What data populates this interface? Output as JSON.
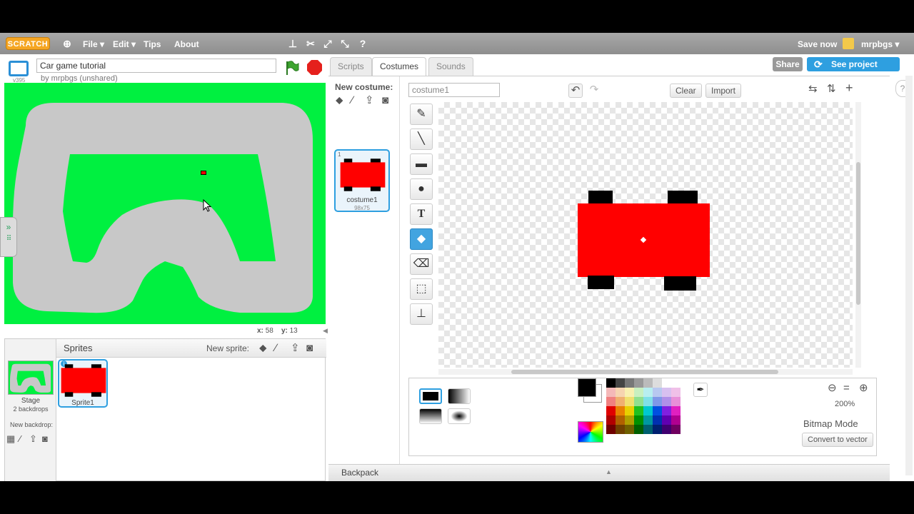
{
  "menubar": {
    "logo": "SCRATCH",
    "items": [
      "File ▾",
      "Edit ▾",
      "Tips",
      "About"
    ],
    "save_now": "Save now",
    "username": "mrpbgs ▾"
  },
  "project": {
    "title": "Car game tutorial",
    "version": "v395",
    "author": "by mrpbgs (unshared)",
    "share": "Share",
    "see_project_page": "See project page"
  },
  "stage": {
    "coords_x_label": "x:",
    "coords_x": "58",
    "coords_y_label": "y:",
    "coords_y": "13",
    "track_color": "#c8c8c8",
    "grass_color": "#00f040"
  },
  "sprites_pane": {
    "header": "Sprites",
    "new_sprite": "New sprite:",
    "stage_label": "Stage",
    "stage_sub": "2 backdrops",
    "new_backdrop": "New backdrop:",
    "sprite_name": "Sprite1"
  },
  "tabs": [
    {
      "label": "Scripts",
      "active": false
    },
    {
      "label": "Costumes",
      "active": true
    },
    {
      "label": "Sounds",
      "active": false
    }
  ],
  "costumes": {
    "new_costume": "New costume:",
    "list": [
      {
        "index": "1",
        "name": "costume1",
        "size": "98x75"
      }
    ]
  },
  "paint": {
    "costume_name": "costume1",
    "clear": "Clear",
    "import": "Import",
    "zoom": "200%",
    "mode": "Bitmap Mode",
    "convert": "Convert to vector",
    "active_tool": "fill-icon",
    "primary_color": "#000000",
    "car_color": "#ff0000"
  },
  "backpack": {
    "label": "Backpack"
  }
}
